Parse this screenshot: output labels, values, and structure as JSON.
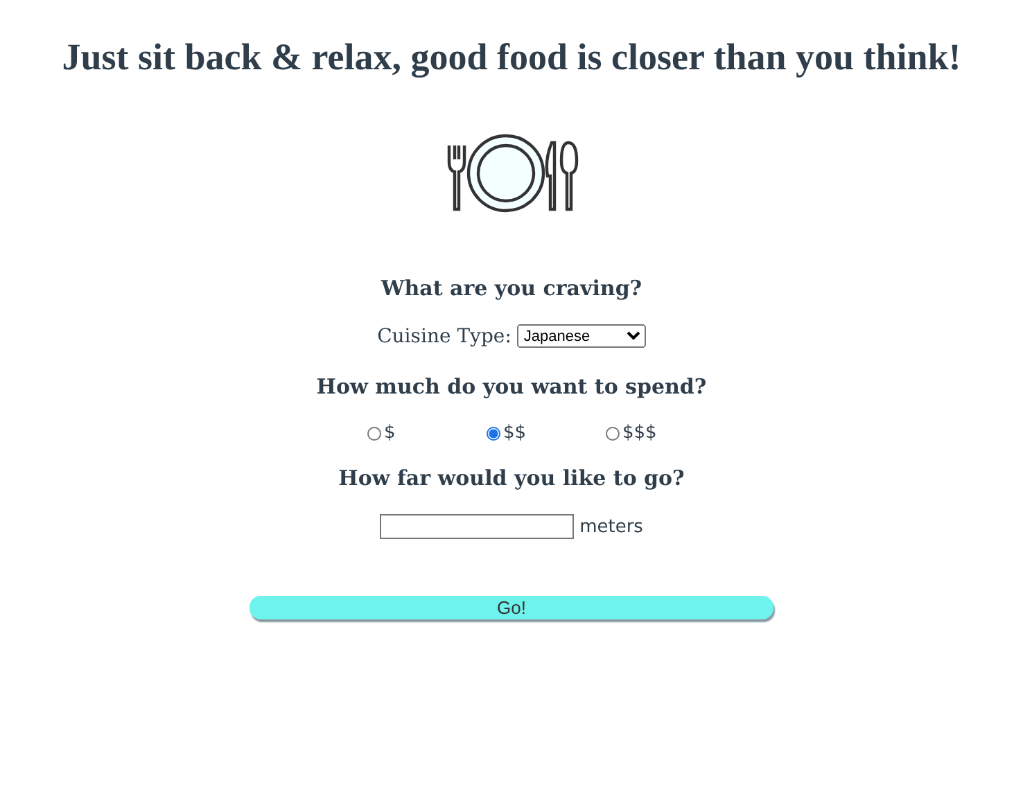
{
  "heading": "Just sit back & relax, good food is closer than you think!",
  "craving": {
    "title": "What are you craving?",
    "label": "Cuisine Type:",
    "value": "Japanese"
  },
  "spend": {
    "title": "How much do you want to spend?",
    "options": [
      {
        "label": "$",
        "selected": false
      },
      {
        "label": "$$",
        "selected": true
      },
      {
        "label": "$$$",
        "selected": false
      }
    ]
  },
  "distance": {
    "title": "How far would you like to go?",
    "unit": "meters"
  },
  "button": "Go!"
}
